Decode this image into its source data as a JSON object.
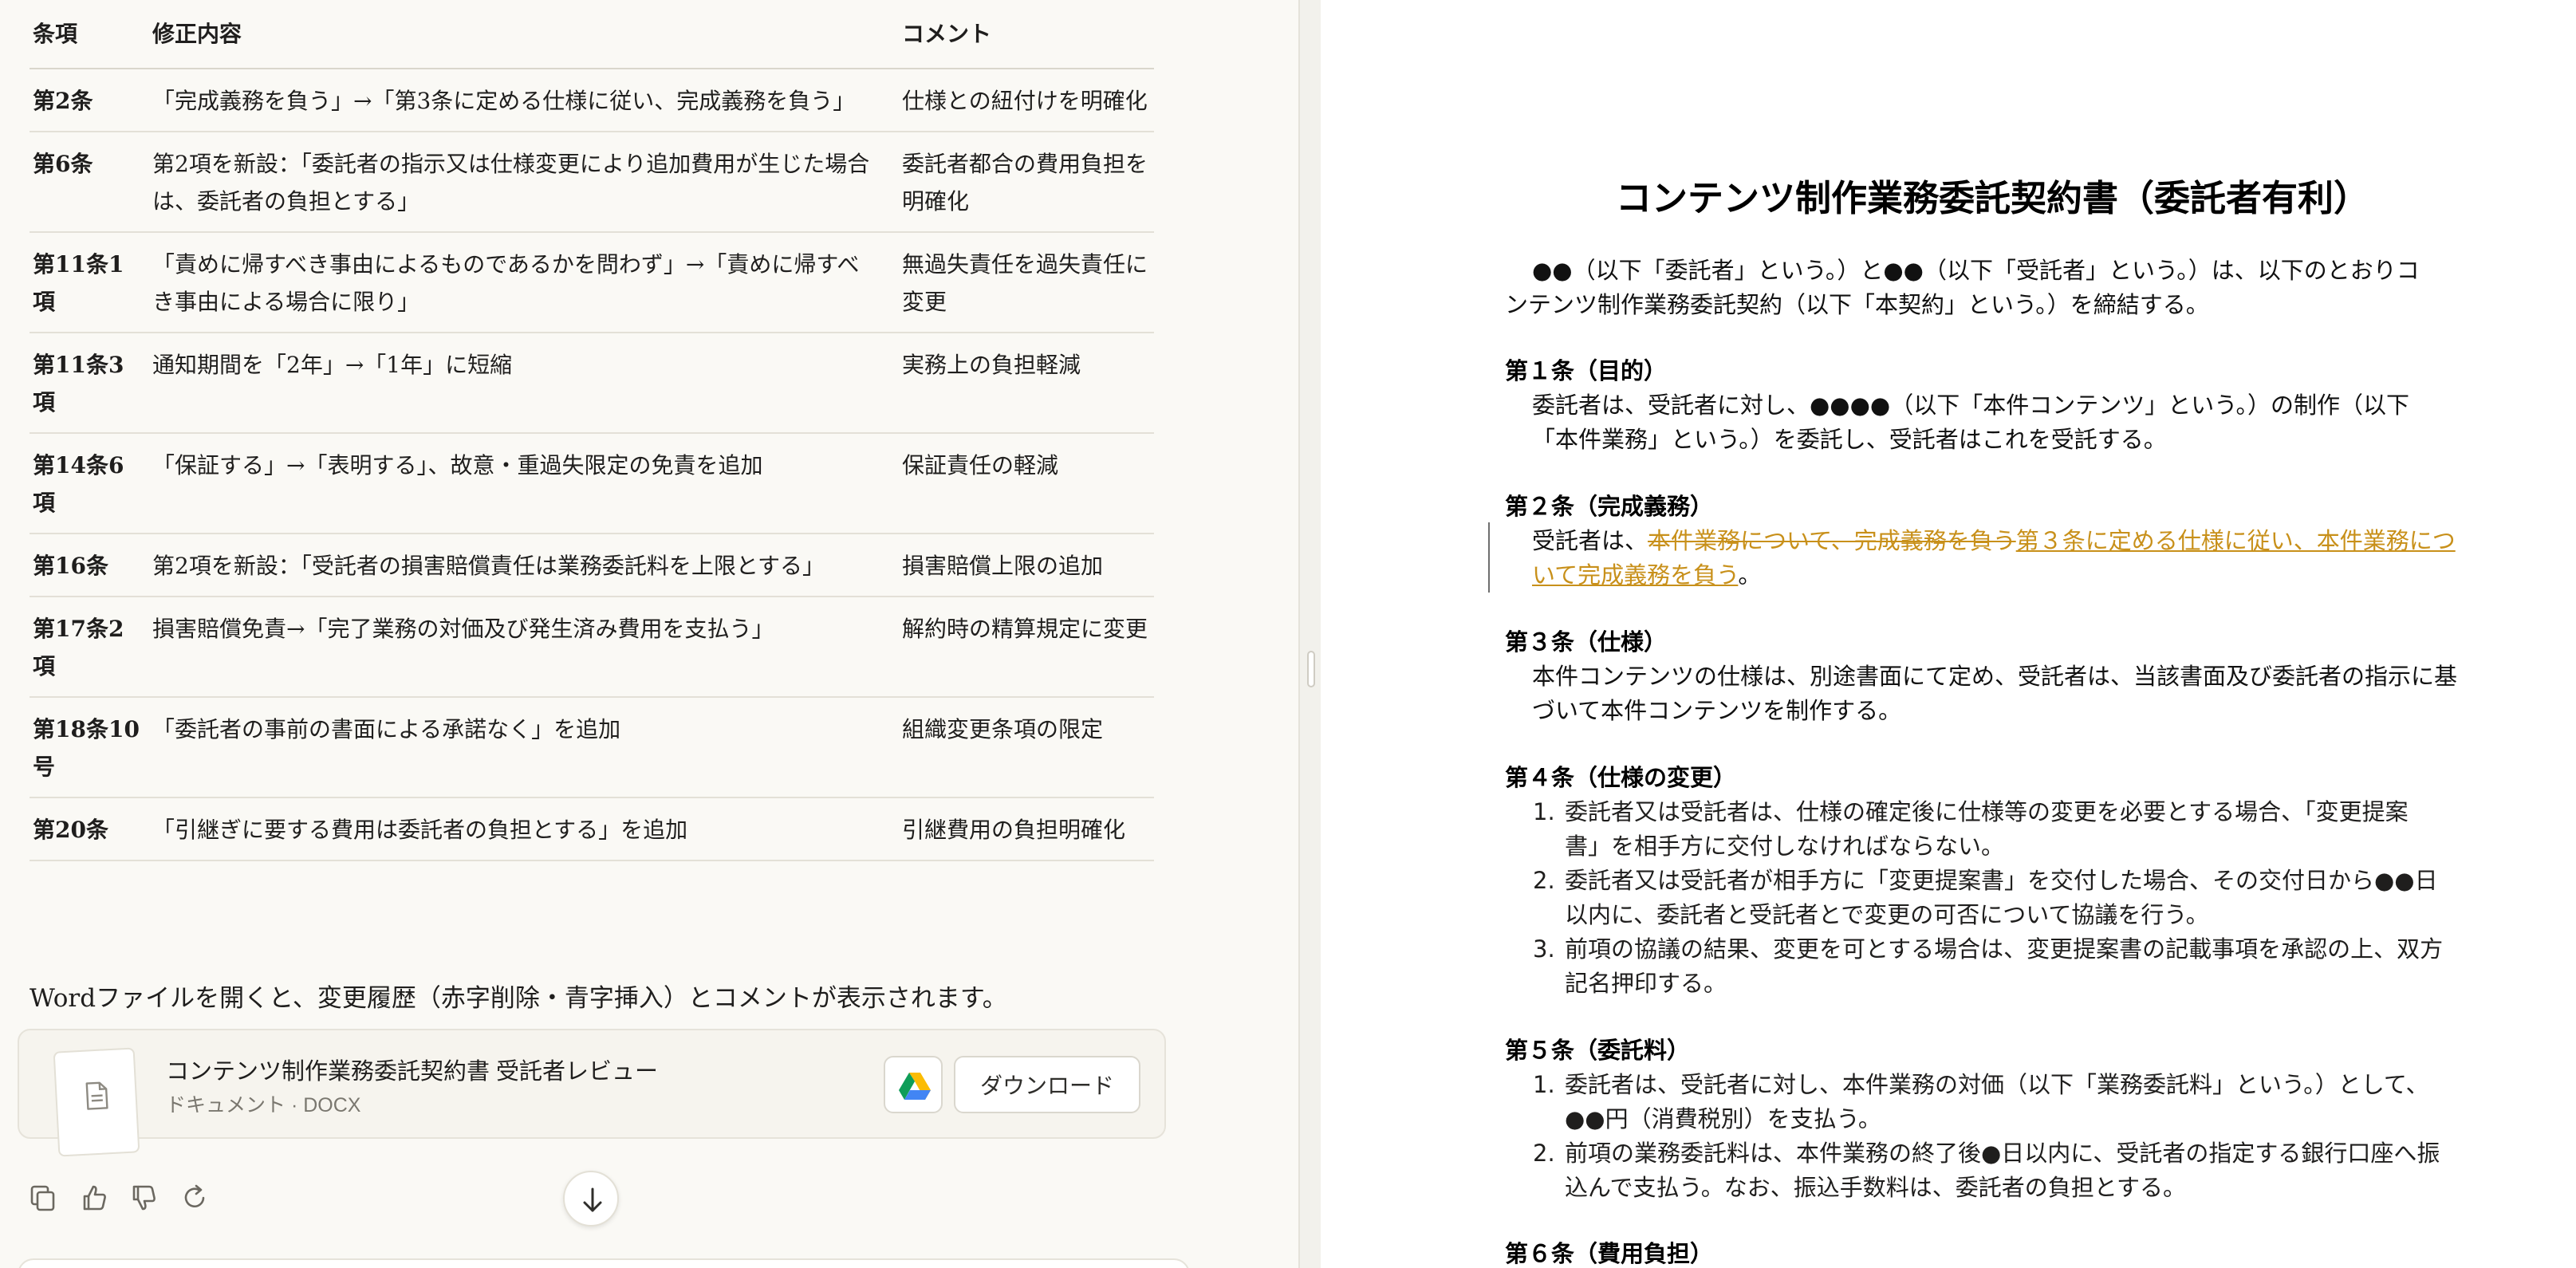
{
  "table": {
    "headers": {
      "clause": "条項",
      "change": "修正内容",
      "comment": "コメント"
    },
    "rows": [
      {
        "clause": "第2条",
        "change": "「完成義務を負う」→「第3条に定める仕様に従い、完成義務を負う」",
        "comment": "仕様との紐付けを明確化"
      },
      {
        "clause": "第6条",
        "change": "第2項を新設：「委託者の指示又は仕様変更により追加費用が生じた場合は、委託者の負担とする」",
        "comment": "委託者都合の費用負担を明確化"
      },
      {
        "clause": "第11条1項",
        "change": "「責めに帰すべき事由によるものであるかを問わず」→「責めに帰すべき事由による場合に限り」",
        "comment": "無過失責任を過失責任に変更"
      },
      {
        "clause": "第11条3項",
        "change": "通知期間を「2年」→「1年」に短縮",
        "comment": "実務上の負担軽減"
      },
      {
        "clause": "第14条6項",
        "change": "「保証する」→「表明する」、故意・重過失限定の免責を追加",
        "comment": "保証責任の軽減"
      },
      {
        "clause": "第16条",
        "change": "第2項を新設：「受託者の損害賠償責任は業務委託料を上限とする」",
        "comment": "損害賠償上限の追加"
      },
      {
        "clause": "第17条2項",
        "change": "損害賠償免責→「完了業務の対価及び発生済み費用を支払う」",
        "comment": "解約時の精算規定に変更"
      },
      {
        "clause": "第18条10号",
        "change": "「委託者の事前の書面による承諾なく」を追加",
        "comment": "組織変更条項の限定"
      },
      {
        "clause": "第20条",
        "change": "「引継ぎに要する費用は委託者の負担とする」を追加",
        "comment": "引継費用の負担明確化"
      }
    ]
  },
  "note": "Wordファイルを開くと、変更履歴（赤字削除・青字挿入）とコメントが表示されます。",
  "file_card": {
    "title": "コンテンツ制作業務委託契約書 受託者レビュー",
    "meta": "ドキュメント · DOCX",
    "download_label": "ダウンロード",
    "drive_icon": "google-drive-icon",
    "file_icon": "document-icon"
  },
  "actions": {
    "icons": [
      "copy-icon",
      "thumbs-up-icon",
      "thumbs-down-icon",
      "retry-icon"
    ],
    "scroll_icon": "arrow-down-icon"
  },
  "document": {
    "title": "コンテンツ制作業務委託契約書（委託者有利）",
    "intro_1": "●●（以下「委託者」という。）と●●（以下「受託者」という。）は、以下のとおりコ",
    "intro_2": "ンテンツ制作業務委託契約（以下「本契約」という。）を締結する。",
    "a1_heading": "第１条（目的）",
    "a1_line1": "委託者は、受託者に対し、●●●●（以下「本件コンテンツ」という。）の制作（以下",
    "a1_line2": "「本件業務」という。）を委託し、受託者はこれを受託する。",
    "a2_heading": "第２条（完成義務）",
    "a2_prefix": "受託者は、",
    "a2_deleted": "本件業務について、完成義務を負う",
    "a2_inserted_1": "第３条に定める仕様に従い、本件業務につ",
    "a2_inserted_2": "いて完成義務を負う",
    "a2_suffix": "。",
    "a3_heading": "第３条（仕様）",
    "a3_line1": "本件コンテンツの仕様は、別途書面にて定め、受託者は、当該書面及び委託者の指示に基",
    "a3_line2": "づいて本件コンテンツを制作する。",
    "a4_heading": "第４条（仕様の変更）",
    "a4_items": [
      {
        "num": "1.",
        "line1": "委託者又は受託者は、仕様の確定後に仕様等の変更を必要とする場合、「変更提案",
        "line2": "書」を相手方に交付しなければならない。"
      },
      {
        "num": "2.",
        "line1": "委託者又は受託者が相手方に「変更提案書」を交付した場合、その交付日から●●日",
        "line2": "以内に、委託者と受託者とで変更の可否について協議を行う。"
      },
      {
        "num": "3.",
        "line1": "前項の協議の結果、変更を可とする場合は、変更提案書の記載事項を承認の上、双方",
        "line2": "記名押印する。"
      }
    ],
    "a5_heading": "第５条（委託料）",
    "a5_items": [
      {
        "num": "1.",
        "line1": "委託者は、受託者に対し、本件業務の対価（以下「業務委託料」という。）として、",
        "line2": "●●円（消費税別）を支払う。"
      },
      {
        "num": "2.",
        "line1": "前項の業務委託料は、本件業務の終了後●日以内に、受託者の指定する銀行口座へ振",
        "line2": "込んで支払う。なお、振込手数料は、委託者の負担とする。"
      }
    ],
    "a6_heading": "第６条（費用負担）",
    "change_color": "#c8901a"
  }
}
